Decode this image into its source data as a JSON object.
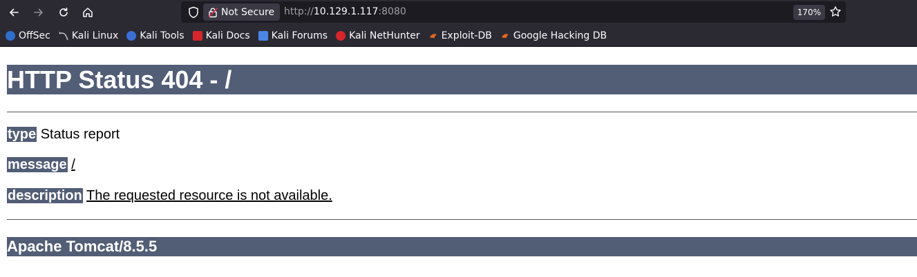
{
  "browser": {
    "security_label": "Not Secure",
    "url_scheme": "http://",
    "url_host": "10.129.1.117",
    "url_port": ":8080",
    "zoom": "170%",
    "bookmarks": [
      {
        "label": "OffSec",
        "icon": "offsec-icon",
        "color": "#2f6ecb"
      },
      {
        "label": "Kali Linux",
        "icon": "kali-dragon-icon",
        "color": "#d0d0d0"
      },
      {
        "label": "Kali Tools",
        "icon": "kali-tools-icon",
        "color": "#3b6fd6"
      },
      {
        "label": "Kali Docs",
        "icon": "kali-docs-icon",
        "color": "#d6262b"
      },
      {
        "label": "Kali Forums",
        "icon": "kali-forums-icon",
        "color": "#4b86e6"
      },
      {
        "label": "Kali NetHunter",
        "icon": "nethunter-icon",
        "color": "#d6262b"
      },
      {
        "label": "Exploit-DB",
        "icon": "exploit-db-icon",
        "color": "#e2681f"
      },
      {
        "label": "Google Hacking DB",
        "icon": "ghdb-icon",
        "color": "#e2681f"
      }
    ]
  },
  "page": {
    "heading": "HTTP Status 404 - /",
    "type_label": "type",
    "type_value": "Status report",
    "message_label": "message",
    "message_value": "/",
    "description_label": "description",
    "description_value": "The requested resource is not available.",
    "footer": "Apache Tomcat/8.5.5"
  },
  "colors": {
    "chrome_bg": "#2b2a33",
    "urlbar_bg": "#1c1b22",
    "tomcat_header": "#525d76"
  }
}
